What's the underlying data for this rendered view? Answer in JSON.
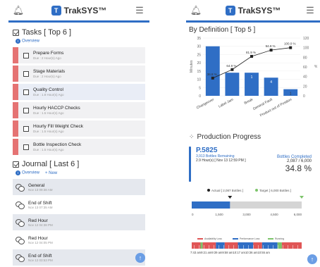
{
  "app": {
    "brand": "TrakSYS™"
  },
  "left": {
    "tasks_title": "Tasks [ Top 6 ]",
    "tasks_overview": "Overview",
    "tasks": [
      {
        "name": "Prepare Forms",
        "due": "Due : 2 Hour(s) Ago"
      },
      {
        "name": "Stage Materials",
        "due": "Due : 2 Hour(s) Ago"
      },
      {
        "name": "Quality Control",
        "due": "Due : 1.8 Hour(s) Ago"
      },
      {
        "name": "Hourly HACCP Checks",
        "due": "Due : 1.5 Hour(s) Ago"
      },
      {
        "name": "Hourly Fill Weight Check",
        "due": "Due : 1.5 Hour(s) Ago"
      },
      {
        "name": "Bottle Inspection Check",
        "due": "Due : 1.5 Hour(s) Ago"
      }
    ],
    "journal_title": "Journal [ Last 6 ]",
    "journal_overview": "Overview",
    "journal_new": "+ New",
    "journal": [
      {
        "name": "General",
        "date": "Nov 13 09:38 AM"
      },
      {
        "name": "End of Shift",
        "date": "Nov 13 07:35 AM"
      },
      {
        "name": "Red Hour",
        "date": "Nov 12 04:38 PM"
      },
      {
        "name": "Red Hour",
        "date": "Nov 12 04:05 PM"
      },
      {
        "name": "End of Shift",
        "date": "Nov 12 03:53 PM"
      }
    ]
  },
  "right": {
    "def_title": "By Definition [ Top 5 ]",
    "chart_data": {
      "type": "bar",
      "categories": [
        "Changeover",
        "Label Jam",
        "Break",
        "General Fault",
        "Product out of Position"
      ],
      "values": [
        30,
        14,
        14,
        11,
        4
      ],
      "bar_labels": [
        "",
        "",
        "1",
        "4",
        "1"
      ],
      "line_values": [
        36.8,
        54.5,
        81.9,
        94.9,
        100.0
      ],
      "line_labels": [
        "36.8 %",
        "64.9 %",
        "81.9 %",
        "94.9 %",
        "100.0 %"
      ],
      "ylim": [
        0,
        35
      ],
      "yticks": [
        "0",
        "5",
        "10",
        "15",
        "20",
        "25",
        "30",
        "35"
      ],
      "y2ticks": [
        "0",
        "20",
        "40",
        "60",
        "80",
        "100",
        "120"
      ],
      "ylabel": "Minutes",
      "y2label": "%",
      "colors": {
        "bar": "#2f6ec5",
        "line": "#222222"
      }
    },
    "pp_title": "Production Progress",
    "pp_code": "P.5825",
    "pp_remaining": "3,913 Bottles Remaining",
    "pp_time": "2.9 Hour(s) [ Nov 13 12:59 PM ]",
    "pp_completed_label": "Bottles Completed",
    "pp_completed": "2,087 / 6,000",
    "pp_percent": "34.8 %",
    "legend_actual": "Actual [ 2,087 Bottles ]",
    "legend_target": "Target [ 6,000 Bottles ]",
    "progress_fraction": 0.348,
    "axis_ticks": [
      "0",
      "1,500",
      "3,000",
      "4,500",
      "6,000"
    ],
    "legend2": [
      "Availability Loss",
      "Performance Loss",
      "Running"
    ],
    "timeline_text": "7:43 am9:21 am9:39 am9:58 am10:17 am10:36 am10:55 am",
    "colors": {
      "actual": "#222222",
      "target": "#7cc46a",
      "progress": "#2f6ec5",
      "availability": "#e05656",
      "performance": "#2f6ec5",
      "running": "#7cc46a"
    }
  }
}
